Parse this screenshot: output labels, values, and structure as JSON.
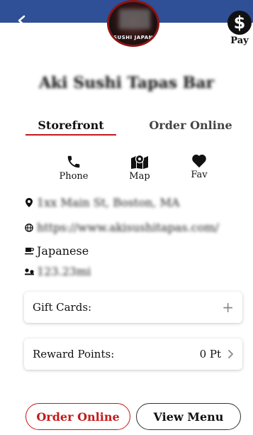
{
  "header": {
    "logo_text": "SUSHI JAPAN",
    "pay_label": "Pay",
    "pay_symbol": "$"
  },
  "store": {
    "name": "Aki Sushi Tapas Bar"
  },
  "tabs": [
    {
      "label": "Storefront",
      "active": true
    },
    {
      "label": "Order Online",
      "active": false
    }
  ],
  "actions": [
    {
      "label": "Phone",
      "icon": "phone-icon"
    },
    {
      "label": "Map",
      "icon": "map-icon"
    },
    {
      "label": "Fav",
      "icon": "heart-icon"
    }
  ],
  "info": {
    "address": "1xx Main St, Boston, MA",
    "website": "https://www.akisushitapas.com/",
    "cuisine": "Japanese",
    "distance": "123.23mi"
  },
  "cards": {
    "gift_cards_label": "Gift Cards:",
    "gift_cards_action": "+",
    "reward_points_label": "Reward Points:",
    "reward_points_value": "0 Pt"
  },
  "bottom_buttons": {
    "order_online": "Order Online",
    "view_menu": "View Menu"
  },
  "colors": {
    "accent": "#c41a1a",
    "header_band": "#2f4f96"
  }
}
